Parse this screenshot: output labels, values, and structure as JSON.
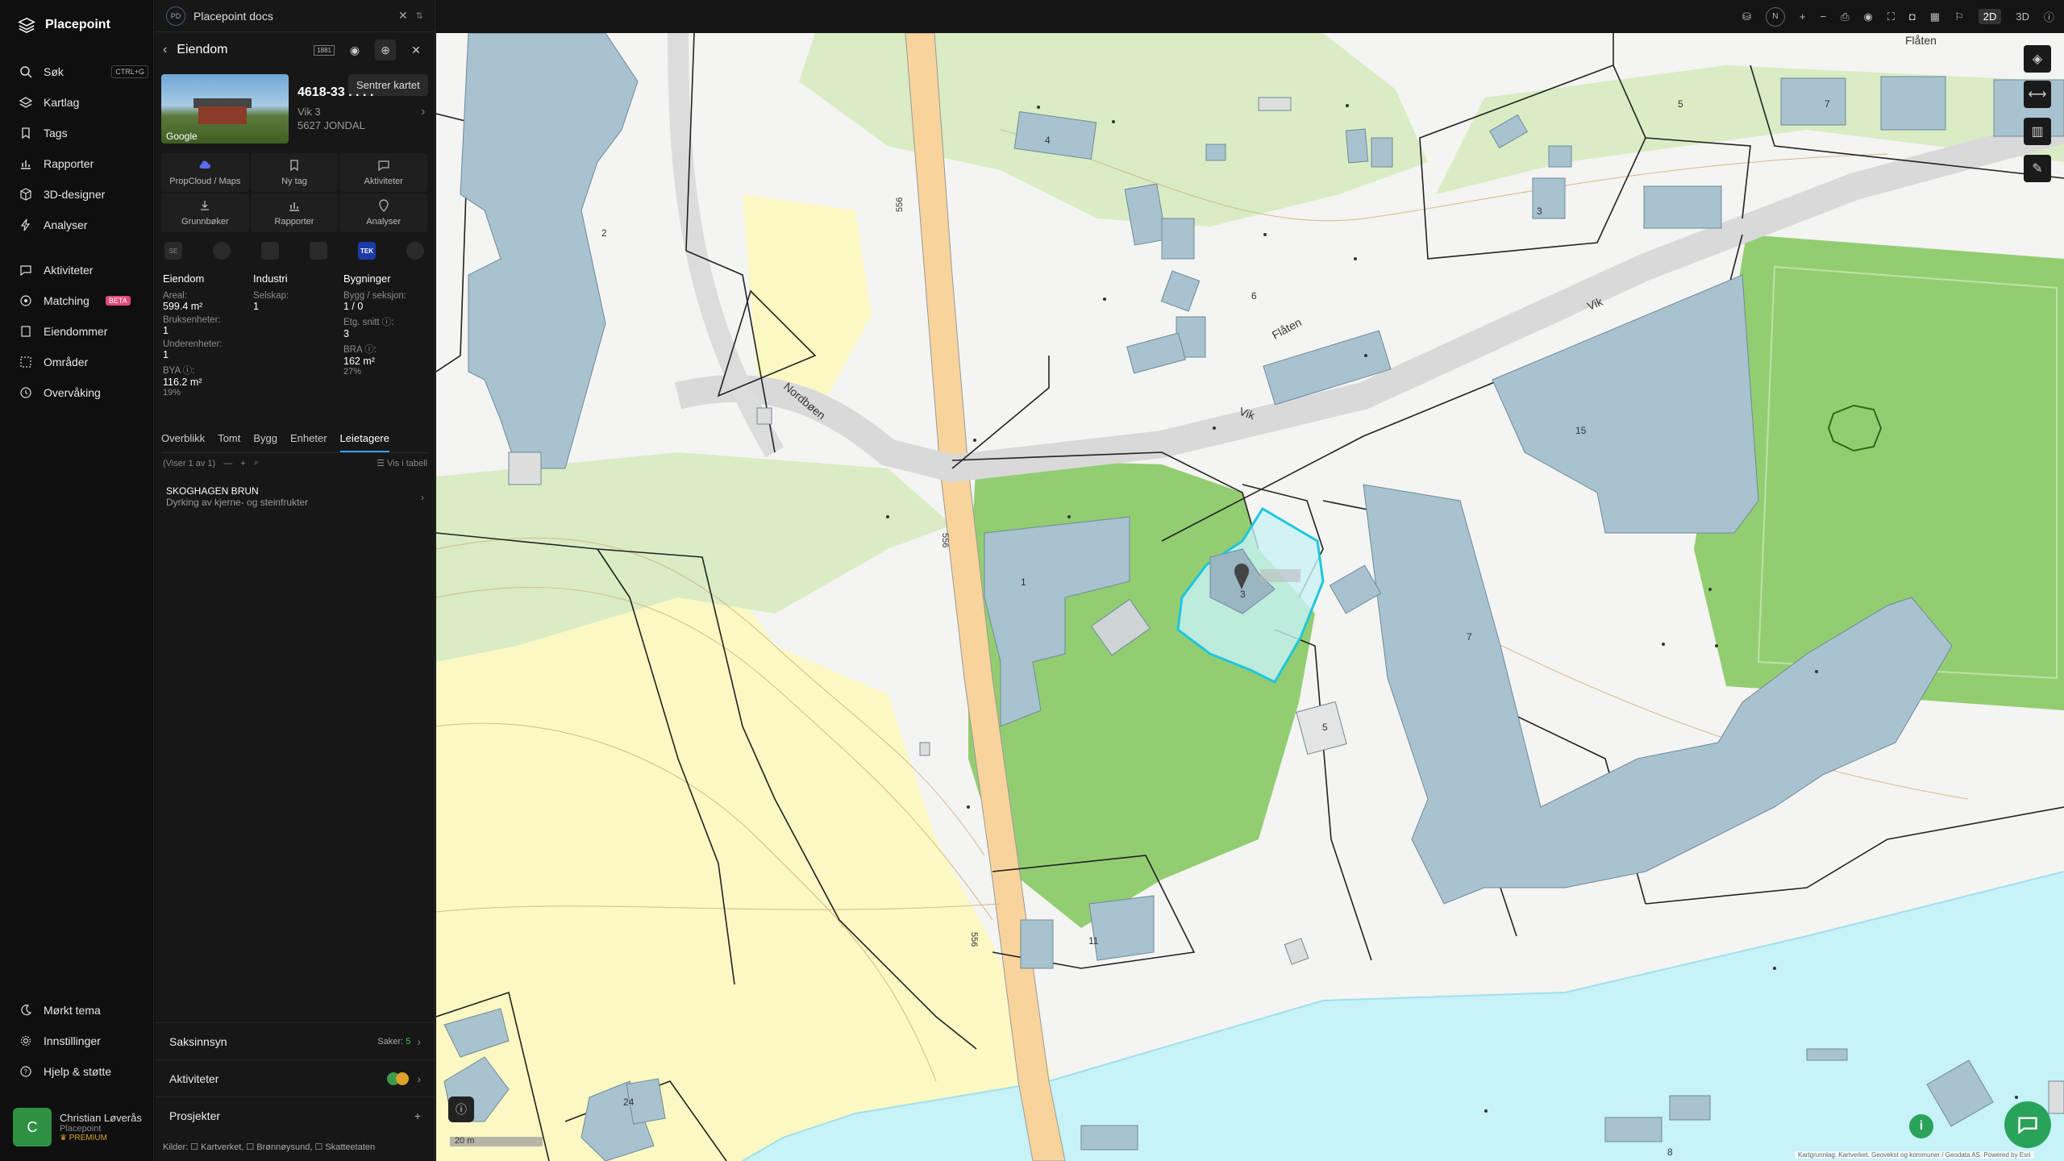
{
  "app": {
    "name": "Placepoint"
  },
  "nav": {
    "items": [
      {
        "label": "Søk",
        "shortcut": "CTRL+G"
      },
      {
        "label": "Kartlag"
      },
      {
        "label": "Tags"
      },
      {
        "label": "Rapporter"
      },
      {
        "label": "3D-designer"
      },
      {
        "label": "Analyser"
      },
      {
        "label": "Aktiviteter"
      },
      {
        "label": "Matching",
        "badge": "BETA"
      },
      {
        "label": "Eiendommer"
      },
      {
        "label": "Områder"
      },
      {
        "label": "Overvåking"
      }
    ],
    "bottom": [
      {
        "label": "Mørkt tema"
      },
      {
        "label": "Innstillinger"
      },
      {
        "label": "Hjelp & støtte"
      }
    ],
    "user": {
      "initial": "C",
      "name": "Christian Løverås",
      "org": "Placepoint",
      "plan": "PREMIUM"
    }
  },
  "panel": {
    "docs": {
      "badge": "PD",
      "title": "Placepoint docs"
    },
    "header": {
      "title": "Eiendom",
      "badge": "1881",
      "tooltip": "Sentrer kartet"
    },
    "property": {
      "id": "4618-33 . . . .",
      "line1": "Vik 3",
      "line2": "5627 JONDAL",
      "photo_label": "Google"
    },
    "actions": [
      "PropCloud / Maps",
      "Ny tag",
      "Aktiviteter",
      "Grunnbøker",
      "Rapporter",
      "Analyser"
    ],
    "sources": [
      "SE",
      "",
      "",
      "",
      "TEK",
      ""
    ],
    "stats": {
      "eiendom": {
        "title": "Eiendom",
        "areal_label": "Areal:",
        "areal": "599.4 m²",
        "bruks_label": "Bruksenheter:",
        "bruks": "1",
        "under_label": "Underenheter:",
        "under": "1",
        "bya_label": "BYA ⓘ:",
        "bya": "116.2 m²",
        "bya_pct": "19%"
      },
      "industri": {
        "title": "Industri",
        "selskap_label": "Selskap:",
        "selskap": "1"
      },
      "bygninger": {
        "title": "Bygninger",
        "bygg_label": "Bygg / seksjon:",
        "bygg": "1 / 0",
        "etg_label": "Etg. snitt ⓘ:",
        "etg": "3",
        "bra_label": "BRA ⓘ:",
        "bra": "162 m²",
        "bra_pct": "27%"
      }
    },
    "tabs": [
      "Overblikk",
      "Tomt",
      "Bygg",
      "Enheter",
      "Leietagere"
    ],
    "list": {
      "showing": "(Viser 1 av 1)",
      "table_label": "Vis i tabell"
    },
    "entry": {
      "name": "SKOGHAGEN BRUN",
      "desc": "Dyrking av kjerne- og steinfrukter"
    },
    "sections": [
      {
        "label": "Saksinnsyn",
        "sub": "Saker:",
        "count": "5"
      },
      {
        "label": "Aktiviteter"
      },
      {
        "label": "Prosjekter"
      }
    ],
    "kilder": "Kilder: ☐ Kartverket, ☐ Brønnøysund, ☐ Skatteetaten"
  },
  "map": {
    "labels": [
      "Flåten",
      "Flåten",
      "Vik",
      "Vik",
      "Nordbøen",
      "556",
      "556",
      "556",
      "4",
      "2",
      "3",
      "6",
      "15",
      "1",
      "3",
      "5",
      "7",
      "11",
      "24",
      "5",
      "7",
      "8"
    ],
    "scale": "20 m",
    "attribution": "Kartgrunnlag: Kartverket, Geovekst og kommuner / Geodata AS. Powered by Esri",
    "toolbar": [
      "2D",
      "3D"
    ],
    "north": "N"
  }
}
